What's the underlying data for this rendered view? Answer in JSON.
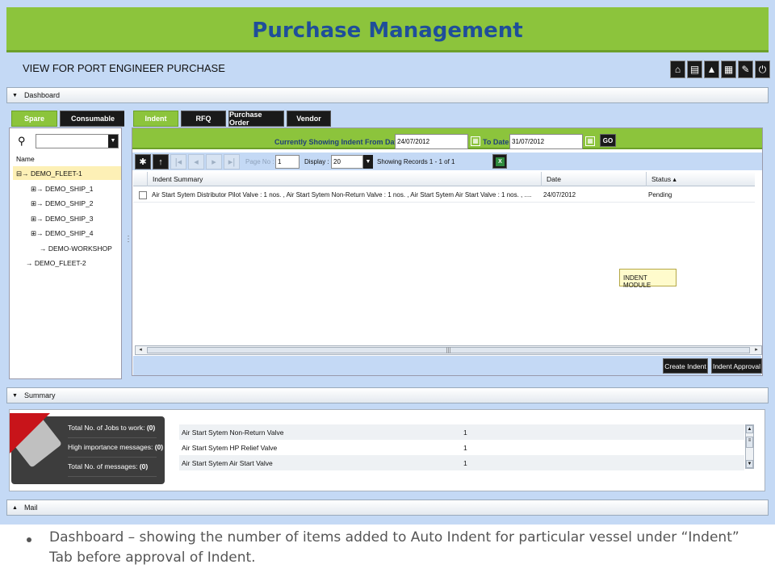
{
  "app": {
    "banner_title": "Purchase Management",
    "view_title": "VIEW FOR PORT ENGINEER PURCHASE",
    "toolbar_icons": [
      "home-icon",
      "print-icon",
      "warning-icon",
      "document-icon",
      "edit-icon",
      "power-icon"
    ]
  },
  "dashboard": {
    "label": "Dashboard",
    "left_tabs": [
      {
        "label": "Spare",
        "active": true
      },
      {
        "label": "Consumable",
        "active": false
      }
    ],
    "name_header": "Name",
    "tree": [
      {
        "label": "DEMO_FLEET-1",
        "expander": "⊟",
        "selected": true
      },
      {
        "label": "DEMO_SHIP_1",
        "expander": "⊞"
      },
      {
        "label": "DEMO_SHIP_2",
        "expander": "⊞"
      },
      {
        "label": "DEMO_SHIP_3",
        "expander": "⊞"
      },
      {
        "label": "DEMO_SHIP_4",
        "expander": "⊞"
      },
      {
        "label": "DEMO-WORKSHOP",
        "expander": ""
      },
      {
        "label": "DEMO_FLEET-2",
        "expander": ""
      }
    ],
    "right_tabs": [
      {
        "label": "Indent",
        "active": true
      },
      {
        "label": "RFQ",
        "active": false
      },
      {
        "label": "Purchase Order",
        "active": false
      },
      {
        "label": "Vendor",
        "active": false
      }
    ],
    "filter": {
      "from_label": "Currently Showing Indent From Date :",
      "from_value": "24/07/2012",
      "to_label": "To Date :",
      "to_value": "31/07/2012",
      "go_label": "GO"
    },
    "pager": {
      "page_label": "Page No :",
      "page_value": "1",
      "display_label": "Display :",
      "display_value": "20",
      "records_text": "Showing Records 1 - 1 of 1"
    },
    "grid": {
      "columns": [
        "Indent Summary",
        "Date",
        "Status ▴"
      ],
      "rows": [
        {
          "summary": "Air Start Sytem Distributor Pilot Valve : 1 nos. , Air Start Sytem Non-Return Valve : 1 nos. , Air Start Sytem Air Start Valve : 1 nos. , ....",
          "date": "24/07/2012",
          "status": "Pending"
        }
      ]
    },
    "tooltip": "INDENT MODULE",
    "buttons": {
      "create": "Create Indent",
      "approval": "Indent Approval"
    }
  },
  "summary": {
    "label": "Summary",
    "stats": [
      {
        "label": "Total No. of Jobs to work:",
        "value": "(0)"
      },
      {
        "label": "High importance messages:",
        "value": "(0)"
      },
      {
        "label": "Total No. of messages:",
        "value": "(0)"
      }
    ],
    "items": [
      {
        "name": "Air Start Sytem Non-Return Valve",
        "qty": "1"
      },
      {
        "name": "Air Start Sytem HP Relief Valve",
        "qty": "1"
      },
      {
        "name": "Air Start Sytem Air Start Valve",
        "qty": "1"
      }
    ]
  },
  "mail": {
    "label": "Mail"
  },
  "caption": "Dashboard – showing the number of items added to Auto Indent for particular vessel under “Indent” Tab before approval of Indent."
}
